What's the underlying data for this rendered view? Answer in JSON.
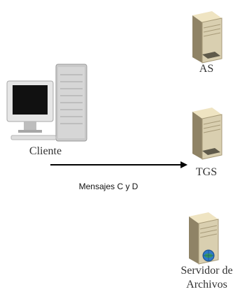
{
  "client": {
    "label": "Cliente"
  },
  "servers": [
    {
      "label": "AS",
      "icon": "server-icon"
    },
    {
      "label": "TGS",
      "icon": "server-icon"
    },
    {
      "label_line1": "Servidor de",
      "label_line2": "Archivos",
      "icon": "file-server-globe-icon"
    }
  ],
  "arrow": {
    "label": "Mensajes C y D",
    "color": "#000000"
  },
  "colors": {
    "server_body": "#d9cfb0",
    "server_shadow": "#8f8366",
    "monitor": "#e6e6e6",
    "screen": "#111111",
    "tower": "#c9c9c9"
  }
}
